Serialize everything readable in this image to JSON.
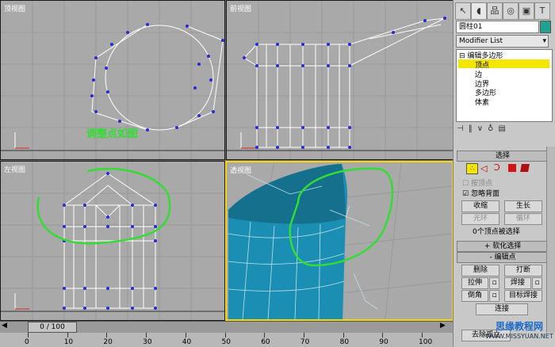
{
  "viewports": {
    "top": {
      "label": "顶视图"
    },
    "front": {
      "label": "前视图"
    },
    "left": {
      "label": "左视图"
    },
    "persp": {
      "label": "透视图"
    }
  },
  "annotation": "调整点如图",
  "colors": {
    "accent": "#f5d900",
    "annotation_green": "#33dd33",
    "vertex": "#2a2ad8",
    "object": "#1b8fb3"
  },
  "panel": {
    "tabs": [
      "create-icon",
      "modify-icon",
      "hierarchy-icon",
      "motion-icon",
      "display-icon",
      "utilities-icon"
    ],
    "object_name": "圆柱01",
    "modifier_list": "Modifier List",
    "stack": {
      "root": "编辑多边形",
      "items": [
        "顶点",
        "边",
        "边界",
        "多边形",
        "体素"
      ]
    },
    "selection_rollout": "选择",
    "by_vertex": "按顶点",
    "ignore_backfacing": "忽略背面",
    "shrink": "收缩",
    "grow": "生长",
    "ring": "光环",
    "loop": "循环",
    "selected_info": "0个顶点被选择",
    "soft_selection": "软化选择",
    "edit_vertices": "编辑点",
    "remove": "删除",
    "break": "打断",
    "extrude": "拉伸",
    "weld": "焊接",
    "chamfer": "倒角",
    "target_weld": "目标焊接",
    "connect": "连接",
    "remove_isolated": "去除孤立"
  },
  "timeline": {
    "slider": "0 / 100",
    "ticks": [
      "0",
      "10",
      "20",
      "30",
      "40",
      "50",
      "60",
      "70",
      "80",
      "90",
      "100"
    ]
  },
  "watermark": {
    "title": "思缘教程网",
    "url": "WWW.MISSYUAN.NET"
  }
}
